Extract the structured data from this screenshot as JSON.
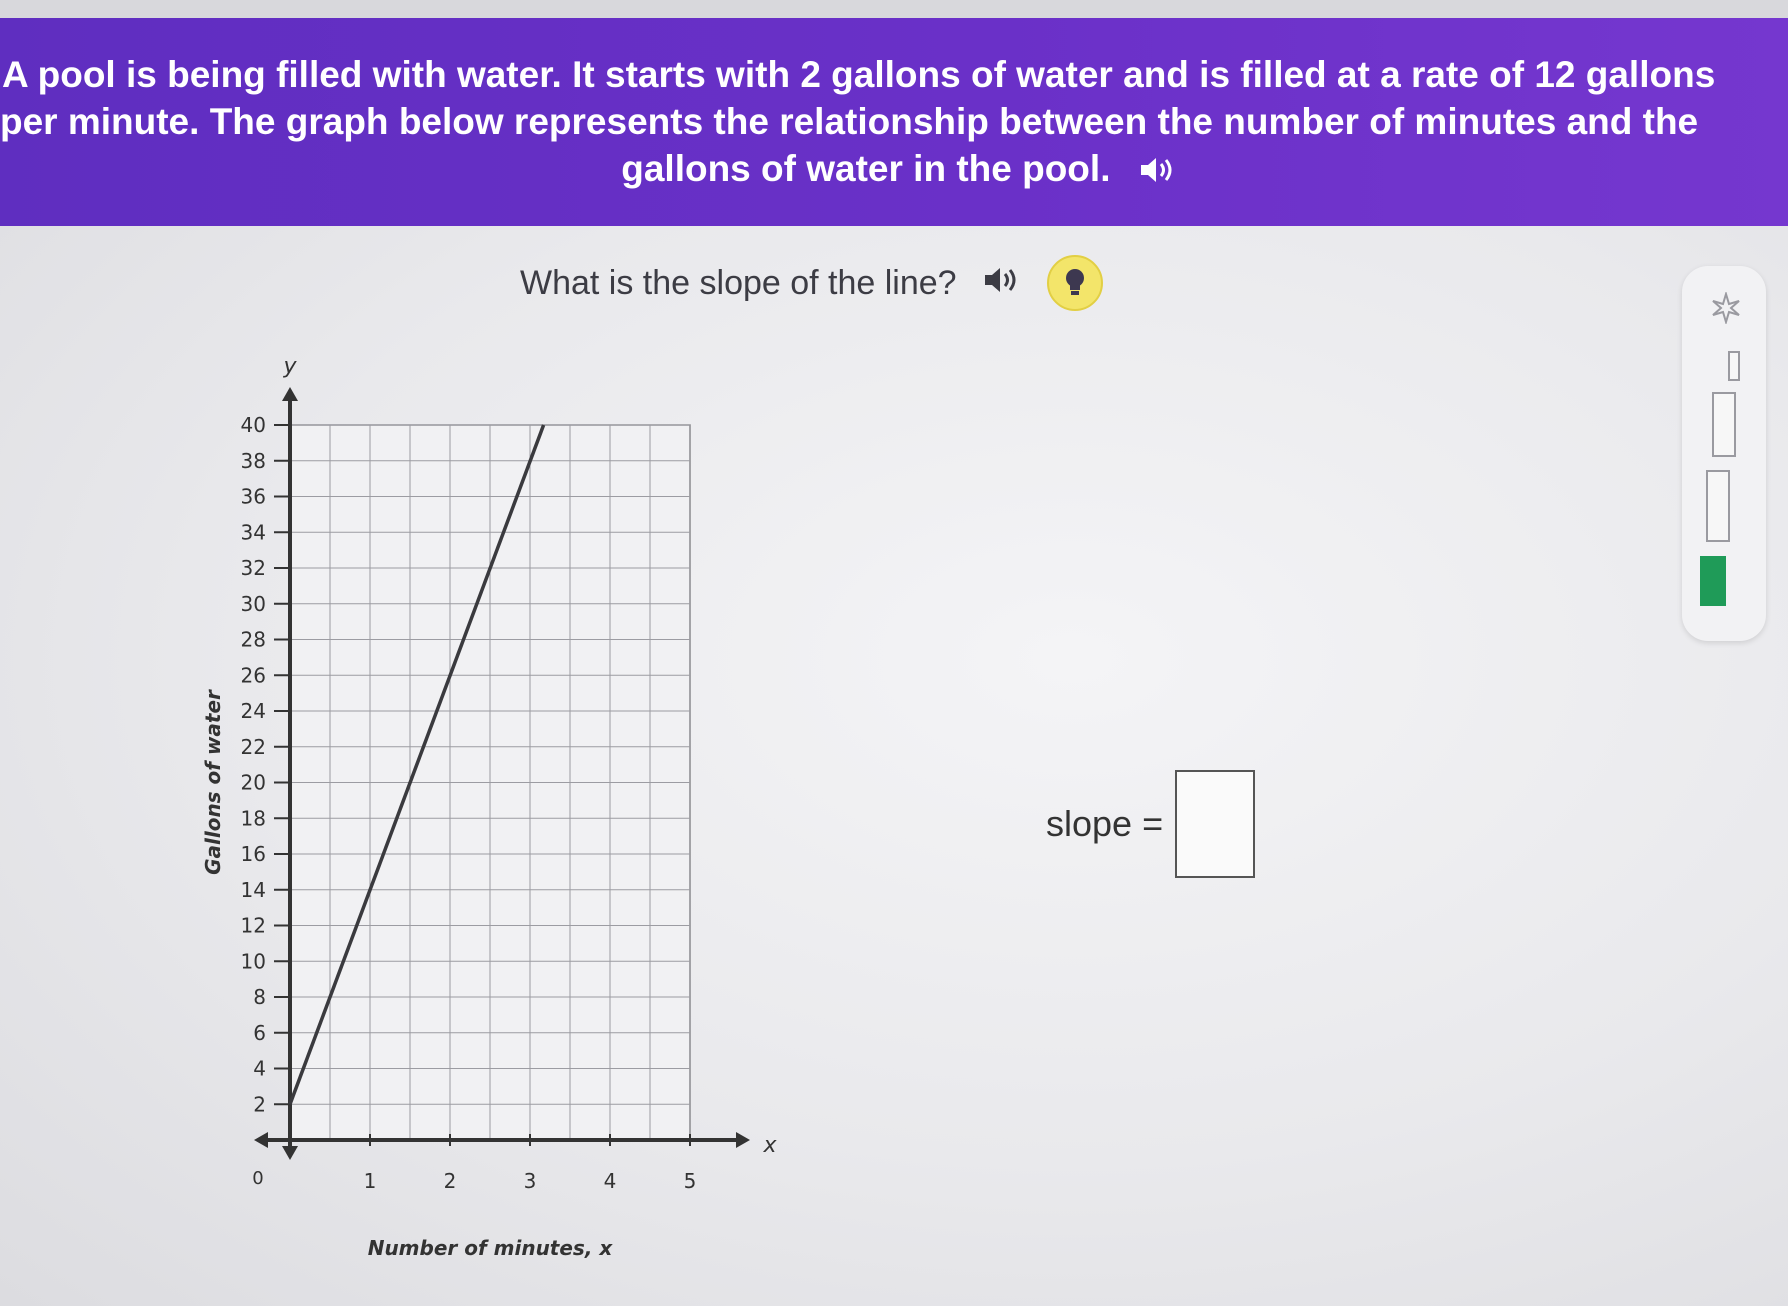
{
  "problem": {
    "line1": "A pool is being filled with water. It starts with 2 gallons of water and is filled at a rate of 12 gallons",
    "line2": "per minute. The graph below represents the relationship between the number of minutes and the",
    "line3": "gallons of water in the pool."
  },
  "question": {
    "text": "What is the slope of the line?",
    "speaker_icon": "speaker-icon",
    "hint_icon": "lightbulb-icon"
  },
  "answer": {
    "label": "slope =",
    "value": ""
  },
  "progress": {
    "icon": "sparkle-icon",
    "levels_total": 4,
    "levels_filled": 1,
    "fill_color": "#1f9b58"
  },
  "colors": {
    "banner": "#6a30c8",
    "hint": "#f3e56a"
  },
  "chart_data": {
    "type": "line",
    "xlabel": "Number of minutes, x",
    "ylabel": "Gallons of water",
    "x_axis_var": "x",
    "y_axis_var": "y",
    "origin_label": "0",
    "xlim": [
      0,
      5
    ],
    "ylim": [
      0,
      40
    ],
    "x_ticks": [
      1,
      2,
      3,
      4,
      5
    ],
    "y_ticks": [
      2,
      4,
      6,
      8,
      10,
      12,
      14,
      16,
      18,
      20,
      22,
      24,
      26,
      28,
      30,
      32,
      34,
      36,
      38,
      40
    ],
    "grid": true,
    "series": [
      {
        "x": [
          0,
          3.17
        ],
        "y": [
          2,
          40
        ]
      }
    ]
  }
}
